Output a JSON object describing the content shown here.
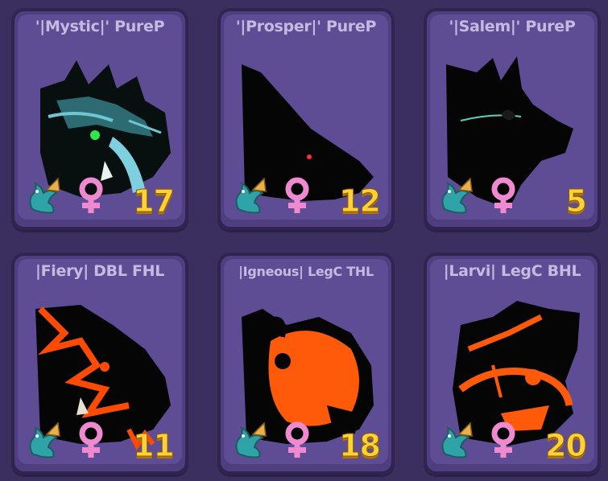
{
  "cards": [
    {
      "name": "'|Mystic|' PureP",
      "level": "17",
      "theme": "teal"
    },
    {
      "name": "'|Prosper|' PureP",
      "level": "12",
      "theme": "dark"
    },
    {
      "name": "'|Salem|' PureP",
      "level": "5",
      "theme": "dark"
    },
    {
      "name": "|Fiery| DBL FHL",
      "level": "11",
      "theme": "orange"
    },
    {
      "name": "|Igneous| LegC THL",
      "level": "18",
      "theme": "orange"
    },
    {
      "name": "|Larvi| LegC BHL",
      "level": "20",
      "theme": "orange"
    }
  ],
  "colors": {
    "background": "#3a2f5e",
    "card": "#5e4d94",
    "level_text": "#ffd23a",
    "gender_icon": "#f08ad0",
    "species_icon": "#2fa3a8",
    "accent_orange": "#ff4a00",
    "accent_teal": "#4fb8c8"
  },
  "icons": {
    "species": "dragon-species-icon",
    "gender": "female-icon"
  }
}
